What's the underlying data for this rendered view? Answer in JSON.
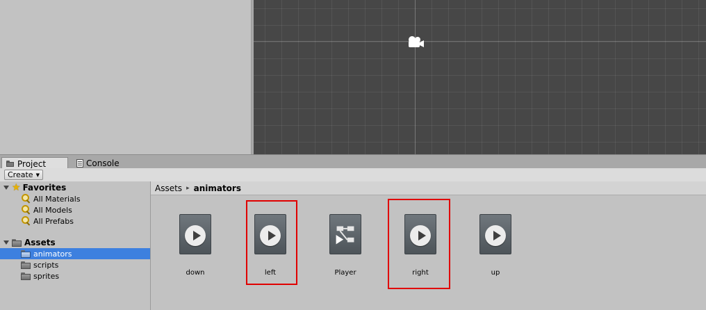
{
  "tabs": {
    "project": "Project",
    "console": "Console"
  },
  "toolbar": {
    "create_label": "Create",
    "create_caret": "▼"
  },
  "tree": {
    "favorites": {
      "label": "Favorites",
      "items": [
        "All Materials",
        "All Models",
        "All Prefabs"
      ]
    },
    "assets": {
      "label": "Assets",
      "items": [
        "animators",
        "scripts",
        "sprites"
      ],
      "selected": "animators"
    }
  },
  "breadcrumb": {
    "root": "Assets",
    "separator": "▸",
    "current": "animators"
  },
  "assets": [
    {
      "name": "down",
      "icon": "animation-clip-icon",
      "highlighted": false
    },
    {
      "name": "left",
      "icon": "animation-clip-icon",
      "highlighted": true
    },
    {
      "name": "Player",
      "icon": "animator-controller-icon",
      "highlighted": false
    },
    {
      "name": "right",
      "icon": "animation-clip-icon",
      "highlighted": true
    },
    {
      "name": "up",
      "icon": "animation-clip-icon",
      "highlighted": false
    }
  ],
  "colors": {
    "selection": "#3d80df",
    "highlight": "#e00000",
    "scene_bg": "#474747"
  }
}
